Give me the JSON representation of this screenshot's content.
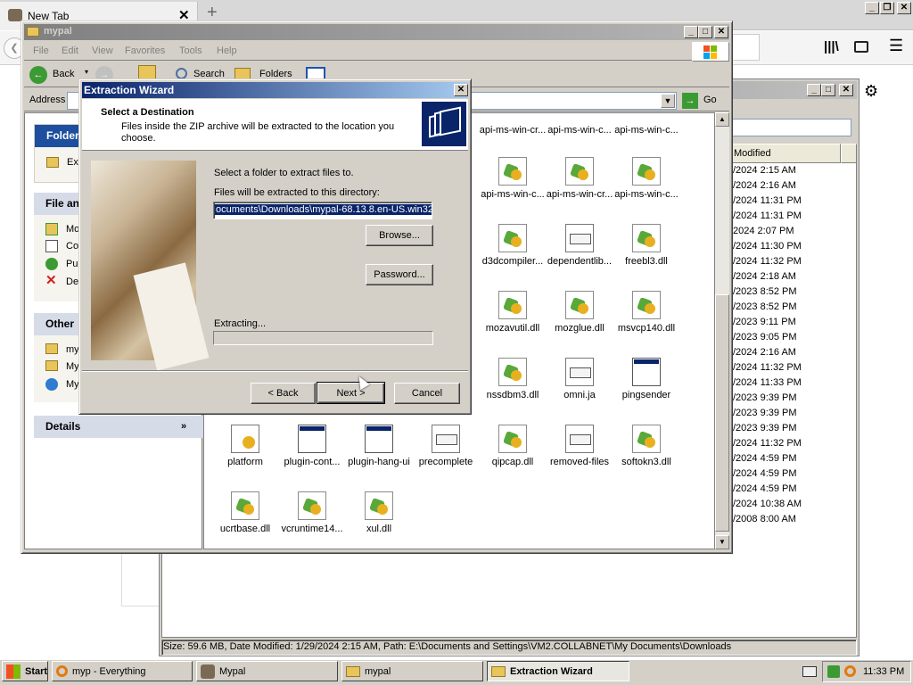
{
  "browser": {
    "tab_title": "New Tab",
    "new_tab_symbol": "+"
  },
  "explorer": {
    "title": "mypal",
    "menu": [
      "File",
      "Edit",
      "View",
      "Favorites",
      "Tools",
      "Help"
    ],
    "toolbar": {
      "back": "Back",
      "search": "Search",
      "folders": "Folders"
    },
    "address_label": "Address",
    "go_label": "Go",
    "left_pane": {
      "folder_tasks_header": "Folder",
      "folder_tasks_item": "Ext",
      "file_tasks_header": "File an",
      "file_tasks_items": [
        "Mo",
        "Co",
        "Pu",
        "De"
      ],
      "other_places_header": "Other",
      "other_places_items": [
        "my",
        "My",
        "My"
      ],
      "details_header": "Details"
    },
    "files": [
      {
        "name": "api-ms-win-cr...",
        "icon": "dll-icon"
      },
      {
        "name": "api-ms-win-c...",
        "icon": "dll-icon"
      },
      {
        "name": "api-ms-win-c...",
        "icon": "dll-icon"
      },
      {
        "name": "api-ms-win-c...",
        "icon": "dll-icon"
      },
      {
        "name": "api-ms-win-cr...",
        "icon": "dll-icon"
      },
      {
        "name": "api-ms-win-c...",
        "icon": "dll-icon"
      },
      {
        "name": "d3dcompiler...",
        "icon": "dll-icon"
      },
      {
        "name": "dependentlib...",
        "icon": "file-icon"
      },
      {
        "name": "freebl3.dll",
        "icon": "dll-icon"
      },
      {
        "name": "mozavutil.dll",
        "icon": "dll-icon"
      },
      {
        "name": "mozglue.dll",
        "icon": "dll-icon"
      },
      {
        "name": "msvcp140.dll",
        "icon": "dll-icon"
      },
      {
        "name": "nssdbm3.dll",
        "icon": "dll-icon"
      },
      {
        "name": "omni.ja",
        "icon": "file-icon"
      },
      {
        "name": "pingsender",
        "icon": "exe-icon"
      },
      {
        "name": "platform",
        "icon": "config-icon"
      },
      {
        "name": "plugin-cont...",
        "icon": "exe-icon"
      },
      {
        "name": "plugin-hang-ui",
        "icon": "exe-icon"
      },
      {
        "name": "precomplete",
        "icon": "file-icon"
      },
      {
        "name": "qipcap.dll",
        "icon": "dll-icon"
      },
      {
        "name": "removed-files",
        "icon": "file-icon"
      },
      {
        "name": "softokn3.dll",
        "icon": "dll-icon"
      },
      {
        "name": "ucrtbase.dll",
        "icon": "dll-icon"
      },
      {
        "name": "vcruntime14...",
        "icon": "dll-icon"
      },
      {
        "name": "xul.dll",
        "icon": "dll-icon"
      }
    ]
  },
  "back_window": {
    "column_header": "Modified",
    "rows": [
      "/2024 2:15 AM",
      "/2024 2:16 AM",
      "/2024 11:31 PM",
      "/2024 11:31 PM",
      "2024 2:07 PM",
      "/2024 11:30 PM",
      "/2024 11:32 PM",
      "/2024 2:18 AM",
      "/2023 8:52 PM",
      "/2023 8:52 PM",
      "/2023 9:11 PM",
      "/2023 9:05 PM",
      "/2024 2:16 AM",
      "/2024 11:32 PM",
      "/2024 11:33 PM",
      "/2023 9:39 PM",
      "/2023 9:39 PM",
      "/2023 9:39 PM",
      "/2024 11:32 PM",
      "/2024 4:59 PM",
      "/2024 4:59 PM",
      "/2024 4:59 PM",
      "/2024 10:38 AM",
      "/2008 8:00 AM"
    ],
    "status_bar": "Size: 59.6 MB, Date Modified: 1/29/2024 2:15 AM, Path: E:\\Documents and Settings\\VM2.COLLABNET\\My Documents\\Downloads"
  },
  "wizard": {
    "title": "Extraction Wizard",
    "heading": "Select a Destination",
    "subheading": "Files inside the ZIP archive will be extracted to the location you choose.",
    "select_label": "Select a folder to extract files to.",
    "dir_label": "Files will be extracted to this directory:",
    "path_value": "ocuments\\Downloads\\mypal-68.13.8.en-US.win32",
    "browse": "Browse...",
    "password": "Password...",
    "extracting": "Extracting...",
    "progress": 0,
    "back": "< Back",
    "next": "Next >",
    "cancel": "Cancel"
  },
  "taskbar": {
    "start": "Start",
    "items": [
      {
        "label": "myp - Everything",
        "icon": "search-icon"
      },
      {
        "label": "Mypal",
        "icon": "mypal-icon"
      },
      {
        "label": "mypal",
        "icon": "folder-icon"
      },
      {
        "label": "Extraction Wizard",
        "icon": "folder-icon",
        "active": true
      }
    ],
    "clock": "11:33 PM"
  },
  "colors": {
    "titlebar_active": "#0a246a",
    "titlebar_inactive": "#808080",
    "face": "#d4d0c8"
  }
}
